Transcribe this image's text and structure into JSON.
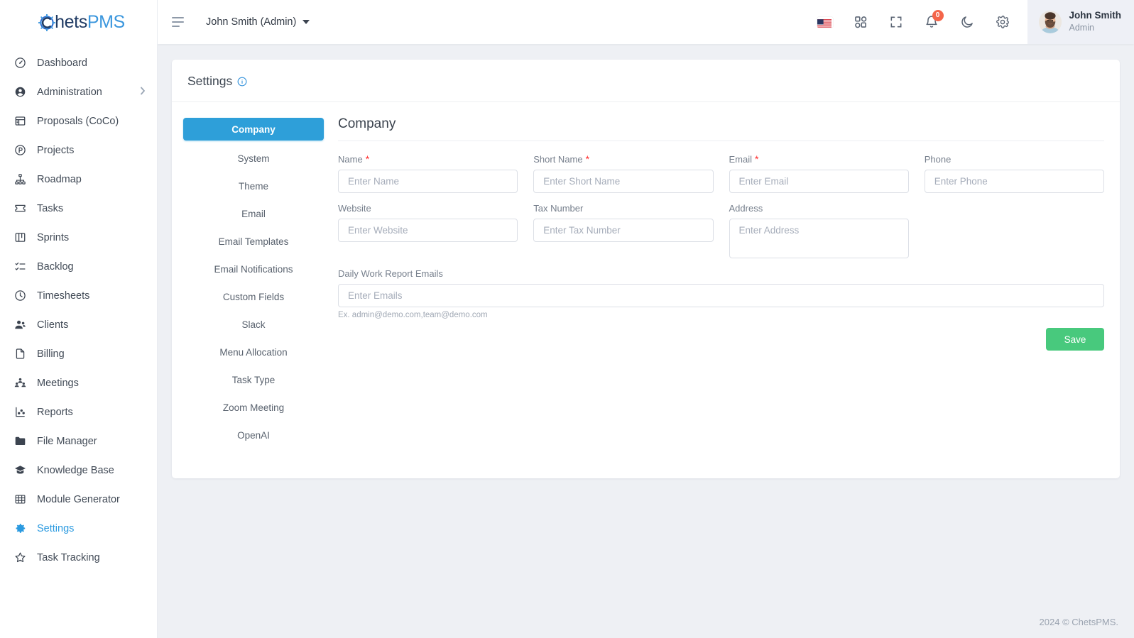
{
  "brand": {
    "name_dark": "hets",
    "name_blue": "PMS",
    "logo_icon": "chets-logo-icon",
    "accent_blue": "#2e9fd9",
    "accent_green": "#48c97d",
    "badge_red": "#f4654a"
  },
  "sidebar": {
    "items": [
      {
        "label": "Dashboard",
        "icon": "speedometer-icon",
        "active": false,
        "has_caret": false
      },
      {
        "label": "Administration",
        "icon": "user-circle-icon",
        "active": false,
        "has_caret": true
      },
      {
        "label": "Proposals (CoCo)",
        "icon": "document-layout-icon",
        "active": false,
        "has_caret": false
      },
      {
        "label": "Projects",
        "icon": "projects-circle-icon",
        "active": false,
        "has_caret": false
      },
      {
        "label": "Roadmap",
        "icon": "hierarchy-icon",
        "active": false,
        "has_caret": false
      },
      {
        "label": "Tasks",
        "icon": "ticket-icon",
        "active": false,
        "has_caret": false
      },
      {
        "label": "Sprints",
        "icon": "board-columns-icon",
        "active": false,
        "has_caret": false
      },
      {
        "label": "Backlog",
        "icon": "checklist-icon",
        "active": false,
        "has_caret": false
      },
      {
        "label": "Timesheets",
        "icon": "clock-icon",
        "active": false,
        "has_caret": false
      },
      {
        "label": "Clients",
        "icon": "people-icon",
        "active": false,
        "has_caret": false
      },
      {
        "label": "Billing",
        "icon": "file-icon",
        "active": false,
        "has_caret": false
      },
      {
        "label": "Meetings",
        "icon": "group-meeting-icon",
        "active": false,
        "has_caret": false
      },
      {
        "label": "Reports",
        "icon": "chart-scatter-icon",
        "active": false,
        "has_caret": false
      },
      {
        "label": "File Manager",
        "icon": "folder-icon",
        "active": false,
        "has_caret": false
      },
      {
        "label": "Knowledge Base",
        "icon": "graduation-cap-icon",
        "active": false,
        "has_caret": false
      },
      {
        "label": "Module Generator",
        "icon": "grid-table-icon",
        "active": false,
        "has_caret": false
      },
      {
        "label": "Settings",
        "icon": "gear-icon",
        "active": true,
        "has_caret": false
      },
      {
        "label": "Task Tracking",
        "icon": "star-icon",
        "active": false,
        "has_caret": false
      }
    ]
  },
  "topbar": {
    "menu_icon": "hamburger-icon",
    "user_switch_label": "John Smith (Admin)",
    "icons": [
      {
        "name": "language-flag-us-icon"
      },
      {
        "name": "apps-grid-icon"
      },
      {
        "name": "fullscreen-icon"
      },
      {
        "name": "notifications-bell-icon",
        "badge": "0"
      },
      {
        "name": "dark-mode-moon-icon"
      },
      {
        "name": "settings-gear-icon"
      }
    ],
    "profile": {
      "name": "John Smith",
      "role": "Admin",
      "avatar": "user-avatar"
    }
  },
  "page": {
    "title": "Settings",
    "info_icon": "info-circle-icon"
  },
  "settings_tabs": [
    {
      "label": "Company",
      "active": true
    },
    {
      "label": "System",
      "active": false
    },
    {
      "label": "Theme",
      "active": false
    },
    {
      "label": "Email",
      "active": false
    },
    {
      "label": "Email Templates",
      "active": false
    },
    {
      "label": "Email Notifications",
      "active": false
    },
    {
      "label": "Custom Fields",
      "active": false
    },
    {
      "label": "Slack",
      "active": false
    },
    {
      "label": "Menu Allocation",
      "active": false
    },
    {
      "label": "Task Type",
      "active": false
    },
    {
      "label": "Zoom Meeting",
      "active": false
    },
    {
      "label": "OpenAI",
      "active": false
    }
  ],
  "form": {
    "heading": "Company",
    "fields": {
      "name": {
        "label": "Name",
        "required": true,
        "placeholder": "Enter Name",
        "value": ""
      },
      "short_name": {
        "label": "Short Name",
        "required": true,
        "placeholder": "Enter Short Name",
        "value": ""
      },
      "email": {
        "label": "Email",
        "required": true,
        "placeholder": "Enter Email",
        "value": ""
      },
      "phone": {
        "label": "Phone",
        "required": false,
        "placeholder": "Enter Phone",
        "value": ""
      },
      "website": {
        "label": "Website",
        "required": false,
        "placeholder": "Enter Website",
        "value": ""
      },
      "tax_number": {
        "label": "Tax Number",
        "required": false,
        "placeholder": "Enter Tax Number",
        "value": ""
      },
      "address": {
        "label": "Address",
        "required": false,
        "placeholder": "Enter Address",
        "value": ""
      },
      "daily_emails": {
        "label": "Daily Work Report Emails",
        "required": false,
        "placeholder": "Enter Emails",
        "value": "",
        "hint": "Ex. admin@demo.com,team@demo.com"
      }
    },
    "save_label": "Save",
    "required_mark": "*"
  },
  "footer": {
    "copyright": "2024 © ChetsPMS."
  }
}
